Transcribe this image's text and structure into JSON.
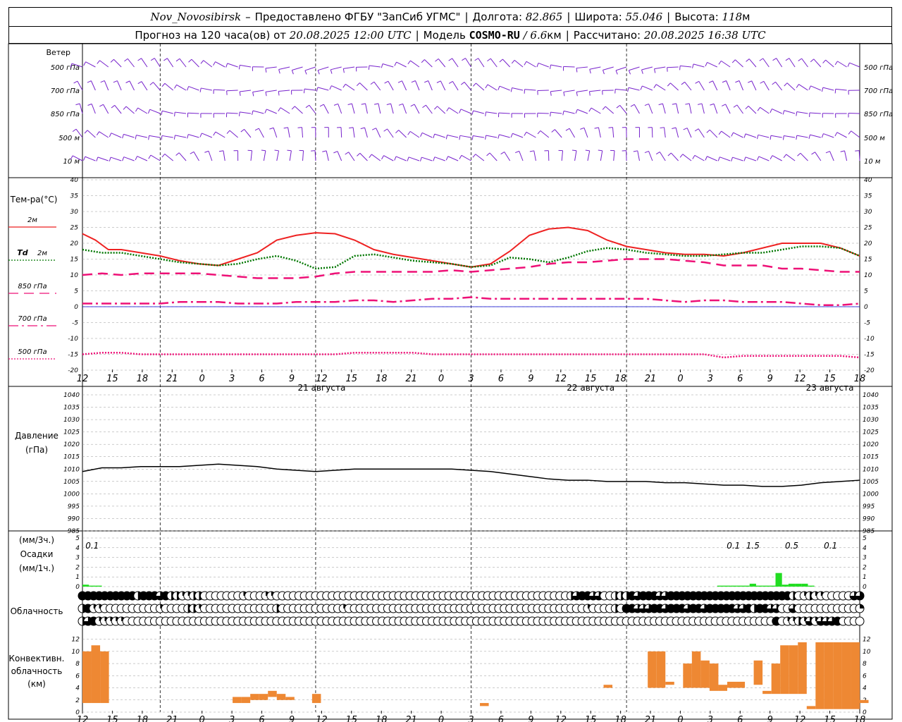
{
  "header": {
    "station": "Nov_Novosibirsk",
    "dash": "–",
    "provider": "Предоставлено ФГБУ \"ЗапСиб УГМС\"",
    "lon_label": "Долгота:",
    "lon": "82.865",
    "lat_label": "Широта:",
    "lat": "55.046",
    "alt_label": "Высота:",
    "alt": "118",
    "alt_unit": "м",
    "fc_label": "Прогноз на 120 часа(ов) от",
    "fc_time": "20.08.2025 12:00 UTC",
    "model_label": "Модель",
    "model": "COSMO-RU",
    "model_res": "/ 6.6",
    "model_res_unit": "км",
    "calc_label": "Рассчитано:",
    "calc_time": "20.08.2025 16:38 UTC"
  },
  "colors": {
    "t2m": "#ee2222",
    "td2m": "#007700",
    "t850": "#ee1177",
    "t700": "#ee1177",
    "t500": "#ee1177",
    "wind": "#7722cc",
    "precip": "#22dd22",
    "convective": "#ee8833",
    "pressure": "#000000",
    "zero_line": "#0000cc"
  },
  "chart_data": [
    {
      "type": "wind_barbs",
      "label": "Ветер",
      "levels": [
        "500 гПа",
        "700 гПа",
        "850 гПа",
        "500 м",
        "10 м"
      ],
      "x_hours": [
        0,
        120
      ]
    },
    {
      "type": "line",
      "ylabel": "Тем-ра(°С)",
      "ylim": [
        -20,
        40
      ],
      "yticks": [
        -20,
        -15,
        -10,
        -5,
        0,
        5,
        10,
        15,
        20,
        25,
        30,
        35,
        40
      ],
      "grid": true,
      "legend_placement": "left",
      "series": [
        {
          "name": "2м",
          "key": "t2m",
          "style": "solid",
          "x": [
            0,
            2,
            4,
            6,
            9,
            12,
            15,
            18,
            21,
            24,
            27,
            30,
            33,
            36,
            39,
            42,
            45,
            48,
            51,
            54,
            57,
            60,
            63,
            66,
            69,
            72,
            75,
            78,
            81,
            84,
            87,
            90,
            93,
            96,
            99,
            102,
            105,
            108,
            111,
            114,
            117,
            120
          ],
          "y": [
            23,
            21,
            18,
            18,
            17,
            16,
            14.5,
            13.5,
            13,
            15,
            17,
            21,
            22.5,
            23.3,
            23,
            21,
            18,
            16.5,
            15.5,
            14.5,
            13.5,
            12.5,
            13.5,
            17.5,
            22.5,
            24.5,
            25,
            24,
            21,
            19,
            18,
            17,
            16.5,
            16.5,
            16,
            17,
            18.5,
            20,
            20,
            20,
            18.5,
            16
          ]
        },
        {
          "name": "2м",
          "prefix": "Td",
          "key": "td2m",
          "style": "dotted",
          "x": [
            0,
            3,
            6,
            9,
            12,
            15,
            18,
            21,
            24,
            27,
            30,
            33,
            36,
            39,
            42,
            45,
            48,
            51,
            54,
            57,
            60,
            63,
            66,
            69,
            72,
            75,
            78,
            81,
            84,
            87,
            90,
            93,
            96,
            99,
            102,
            105,
            108,
            111,
            114,
            117,
            120
          ],
          "y": [
            18,
            17,
            17,
            16,
            15,
            14,
            13.5,
            13,
            13.5,
            15,
            16,
            14.5,
            12,
            12.5,
            16,
            16.5,
            15.5,
            14.5,
            14,
            13.5,
            12.5,
            13,
            15.5,
            15,
            14,
            15.5,
            17.5,
            18.5,
            18,
            17,
            16.5,
            16,
            16,
            16.5,
            17,
            17,
            18,
            19,
            19,
            18.5,
            16
          ]
        },
        {
          "name": "850 гПа",
          "key": "t850",
          "style": "dashed",
          "x": [
            0,
            3,
            6,
            9,
            12,
            15,
            18,
            21,
            24,
            27,
            30,
            33,
            36,
            39,
            42,
            45,
            48,
            51,
            54,
            57,
            60,
            63,
            66,
            69,
            72,
            75,
            78,
            81,
            84,
            87,
            90,
            93,
            96,
            99,
            102,
            105,
            108,
            111,
            114,
            117,
            120
          ],
          "y": [
            10,
            10.5,
            10,
            10.5,
            10.5,
            10.5,
            10.5,
            10,
            9.5,
            9,
            9,
            9,
            9.5,
            10.5,
            11,
            11,
            11,
            11,
            11,
            11.5,
            11,
            11.5,
            12,
            12.5,
            13.5,
            14,
            14,
            14.5,
            15,
            15,
            15,
            14.5,
            14,
            13,
            13,
            13,
            12,
            12,
            11.5,
            11,
            11
          ]
        },
        {
          "name": "700 гПа",
          "key": "t700",
          "style": "dashdot",
          "x": [
            0,
            3,
            6,
            9,
            12,
            15,
            18,
            21,
            24,
            27,
            30,
            33,
            36,
            39,
            42,
            45,
            48,
            51,
            54,
            57,
            60,
            63,
            66,
            69,
            72,
            75,
            78,
            81,
            84,
            87,
            90,
            93,
            96,
            99,
            102,
            105,
            108,
            111,
            114,
            117,
            120
          ],
          "y": [
            1,
            1,
            1,
            1,
            1,
            1.5,
            1.5,
            1.5,
            1,
            1,
            1,
            1.5,
            1.5,
            1.5,
            2,
            2,
            1.5,
            2,
            2.5,
            2.5,
            3,
            2.5,
            2.5,
            2.5,
            2.5,
            2.5,
            2.5,
            2.5,
            2.5,
            2.5,
            2,
            1.5,
            2,
            2,
            1.5,
            1.5,
            1.5,
            1,
            0.5,
            0.5,
            1
          ]
        },
        {
          "name": "500 гПа",
          "key": "t500",
          "style": "dotted",
          "x": [
            0,
            3,
            6,
            9,
            12,
            15,
            18,
            21,
            24,
            27,
            30,
            33,
            36,
            39,
            42,
            45,
            48,
            51,
            54,
            57,
            60,
            63,
            66,
            69,
            72,
            75,
            78,
            81,
            84,
            87,
            90,
            93,
            96,
            99,
            102,
            105,
            108,
            111,
            114,
            117,
            120
          ],
          "y": [
            -15,
            -14.5,
            -14.5,
            -15,
            -15,
            -15,
            -15,
            -15,
            -15,
            -15,
            -15,
            -15,
            -15,
            -15,
            -14.5,
            -14.5,
            -14.5,
            -14.5,
            -15,
            -15,
            -15,
            -15,
            -15,
            -15,
            -15,
            -15,
            -15,
            -15,
            -15,
            -15,
            -15,
            -15,
            -15,
            -16,
            -15.5,
            -15.5,
            -15.5,
            -15.5,
            -15.5,
            -15.5,
            -16
          ]
        }
      ]
    },
    {
      "type": "line",
      "ylabel": "Давление",
      "ylabel2": "(гПа)",
      "ylim": [
        985,
        1040
      ],
      "yticks": [
        985,
        990,
        995,
        1000,
        1005,
        1010,
        1015,
        1020,
        1025,
        1030,
        1035,
        1040
      ],
      "grid": true,
      "series": [
        {
          "key": "pressure",
          "x": [
            0,
            3,
            6,
            9,
            12,
            15,
            18,
            21,
            24,
            27,
            30,
            33,
            36,
            39,
            42,
            45,
            48,
            51,
            54,
            57,
            60,
            63,
            66,
            69,
            72,
            75,
            78,
            81,
            84,
            87,
            90,
            93,
            96,
            99,
            102,
            105,
            108,
            111,
            114,
            117,
            120
          ],
          "y": [
            1009,
            1010.5,
            1010.5,
            1011,
            1011,
            1011,
            1011.5,
            1012,
            1011.5,
            1011,
            1010,
            1009.5,
            1009,
            1009.5,
            1010,
            1010,
            1010,
            1010,
            1010,
            1010,
            1009.5,
            1009,
            1008,
            1007,
            1006,
            1005.5,
            1005.5,
            1005,
            1005,
            1005,
            1004.5,
            1004.5,
            1004,
            1003.5,
            1003.5,
            1003,
            1003,
            1003.5,
            1004.5,
            1005,
            1005.5
          ]
        }
      ]
    },
    {
      "type": "bar",
      "ylabel": "Осадки",
      "ylabel_top": "(мм/3ч.)",
      "ylabel_bottom": "(мм/1ч.)",
      "ylim": [
        0,
        5
      ],
      "yticks": [
        0,
        1,
        2,
        3,
        4,
        5
      ],
      "labels_3h": [
        {
          "x": 1.5,
          "text": "0.1"
        },
        {
          "x": 100.5,
          "text": "0.1"
        },
        {
          "x": 103.5,
          "text": "1.5"
        },
        {
          "x": 109.5,
          "text": "0.5"
        },
        {
          "x": 115.5,
          "text": "0.1"
        }
      ],
      "x": [
        0,
        1,
        2,
        98,
        99,
        100,
        101,
        102,
        103,
        104,
        105,
        106,
        107,
        108,
        109,
        110,
        111,
        112
      ],
      "values": [
        0.2,
        0.1,
        0.1,
        0.1,
        0.1,
        0.1,
        0.1,
        0.1,
        0.3,
        0.1,
        0.1,
        0.1,
        1.4,
        0.2,
        0.3,
        0.3,
        0.3,
        0.1
      ]
    },
    {
      "type": "cloud_cover",
      "label": "Облачность",
      "step_hours": 1,
      "rows": [
        "8 8 8 8 8 8 8 8 8 8 4 8 8 8 6 8 4 4 2 2 4 4 0 0 0 0 0 0 0 2 0 0 0 2 2 0 0 0 0 0 0 0 0 0 0 0 0 0 0 0 0 0 0 0 0 0 0 0 0 0 0 0 0 0 0 0 0 0 0 0 0 0 0 0 0 0 0 0 0 0 0 0 0 0 0 0 0 0 4 6 8 8 6 6 0 0 4 4 4 8 6 8 8 8 6 6 8 8 8 8 8 8 8 8 8 8 8 8 8 8 8 8 8 8 8 8 8 8 4 0 2 4 2 2 0 0 0 0 0 6 6",
        "4 8 2 2 0 0 0 0 0 0 0 0 0 0 2 0 0 0 0 4 4 2 0 0 0 0 0 0 0 0 0 0 0 0 0 4 0 0 0 0 0 0 0 0 0 0 0 2 0 0 0 0 0 0 0 0 0 0 0 0 0 0 0 0 0 0 0 0 0 0 0 0 0 0 0 0 0 0 0 0 0 0 0 0 0 0 0 0 0 0 0 2 0 0 0 0 4 0 8 8 6 6 6 8 8 6 8 8 8 6 8 8 6 8 8 8 8 8 6 6 8 4 8 8 6 6 0 0 6 0 0 0 0 0 0 0 0 0 0 0 2",
        "4 6 8 2 2 2 2 2 0 0 0 0 0 0 0 0 0 0 0 0 0 0 0 0 0 0 0 0 0 0 0 0 0 0 0 0 0 0 0 0 0 0 0 0 0 0 0 0 0 0 0 0 0 0 0 0 0 0 0 0 0 0 0 0 0 0 0 0 0 0 0 0 0 0 0 0 0 0 0 0 0 0 0 0 0 0 0 0 0 0 0 0 0 0 0 0 0 0 0 0 0 0 0 0 0 0 0 0 0 0 0 0 0 0 0 0 0 0 0 0 0 0 0 0 0 8 0 2 2 4 2 6 2 6 6 6 8 0 0 0 0"
      ]
    },
    {
      "type": "bar",
      "subtype": "floating_range",
      "ylabel": [
        "Конвективн.",
        "облачность",
        "(км)"
      ],
      "ylim": [
        0,
        13
      ],
      "yticks": [
        0,
        2,
        4,
        6,
        8,
        10,
        12
      ],
      "bars": [
        [
          0,
          1.5,
          10
        ],
        [
          1,
          1.5,
          11
        ],
        [
          2,
          1.5,
          10
        ],
        [
          17,
          1.5,
          2.5
        ],
        [
          18,
          1.5,
          2.5
        ],
        [
          19,
          2,
          3
        ],
        [
          20,
          2,
          3
        ],
        [
          21,
          2.5,
          3.5
        ],
        [
          22,
          2,
          3
        ],
        [
          23,
          2,
          2.5
        ],
        [
          26,
          1.5,
          3
        ],
        [
          45,
          1,
          1.5
        ],
        [
          59,
          4,
          4.5
        ],
        [
          64,
          4,
          10
        ],
        [
          65,
          4,
          10
        ],
        [
          66,
          4.5,
          5
        ],
        [
          68,
          4,
          8
        ],
        [
          69,
          4,
          10
        ],
        [
          70,
          4,
          8.5
        ],
        [
          71,
          3.5,
          8
        ],
        [
          72,
          3.5,
          4.5
        ],
        [
          73,
          4,
          5
        ],
        [
          74,
          4,
          5
        ],
        [
          76,
          4.5,
          8.5
        ],
        [
          77,
          3,
          3.5
        ],
        [
          78,
          3,
          8
        ],
        [
          79,
          3,
          11
        ],
        [
          80,
          3,
          11
        ],
        [
          81,
          3,
          11.5
        ],
        [
          82,
          0.5,
          1
        ],
        [
          83,
          0.5,
          11.5
        ],
        [
          84,
          0.5,
          11.5
        ],
        [
          85,
          0.5,
          11.5
        ],
        [
          86,
          0.5,
          11.5
        ],
        [
          87,
          0.5,
          11.5
        ],
        [
          88,
          1.5,
          2
        ]
      ]
    }
  ],
  "axis": {
    "ticks": [
      "12",
      "15",
      "18",
      "21",
      "0",
      "3",
      "6",
      "9",
      "12",
      "15",
      "18",
      "21",
      "0",
      "3",
      "6",
      "9",
      "12",
      "15",
      "18",
      "21",
      "0",
      "3",
      "6",
      "9",
      "12",
      "15",
      "18"
    ],
    "dates": [
      {
        "x": 33,
        "text": "21 августа"
      },
      {
        "x": 57,
        "text": "22 августа"
      },
      {
        "x": 81,
        "text": "23 августа"
      }
    ]
  }
}
